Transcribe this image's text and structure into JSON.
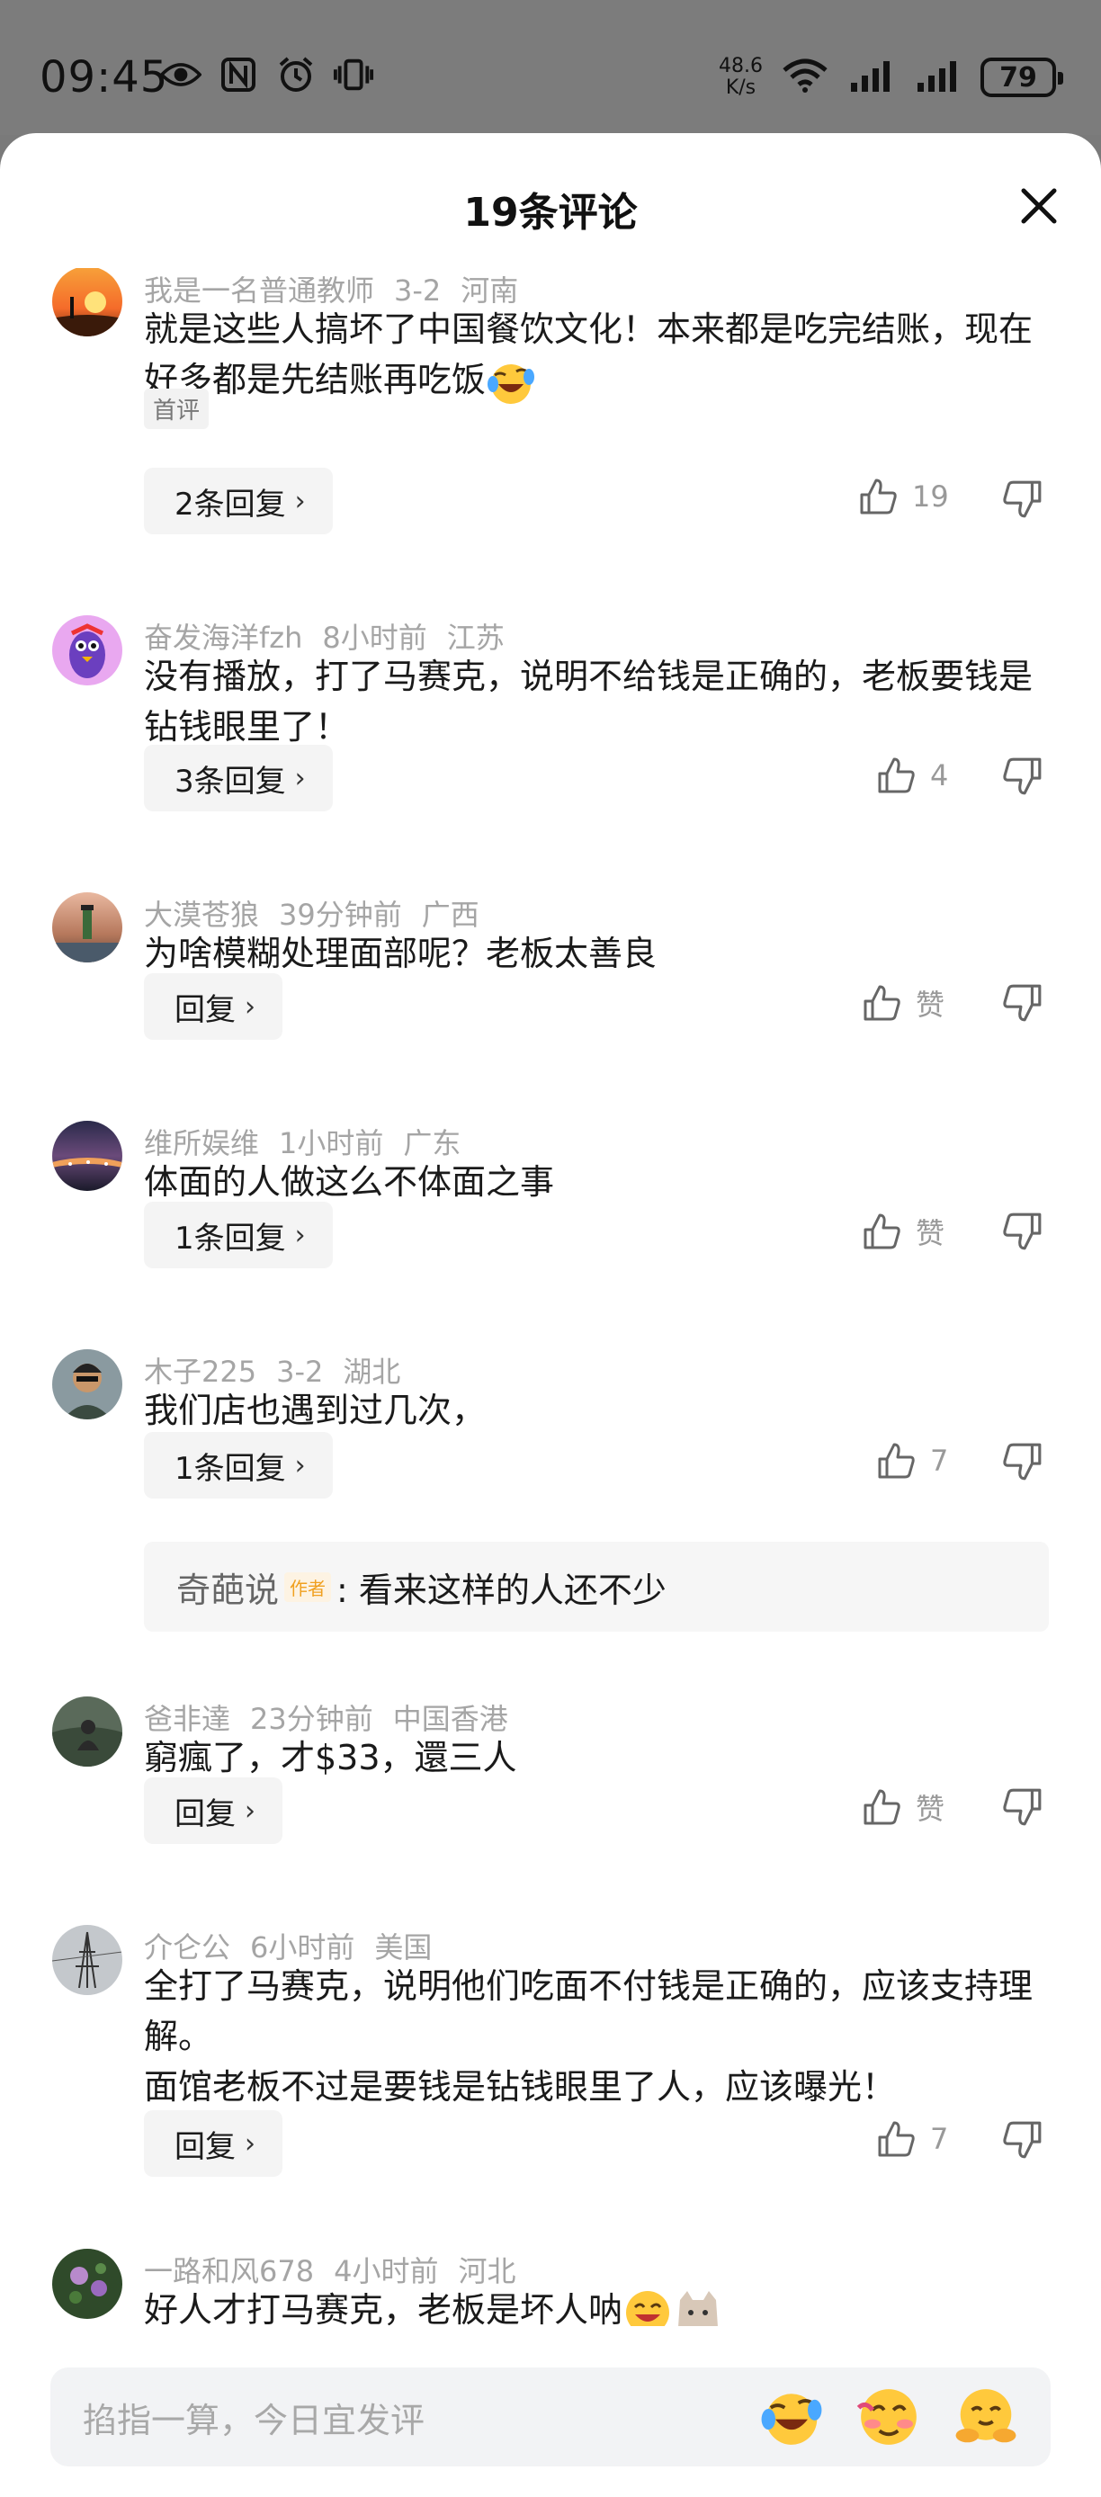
{
  "status_bar": {
    "time": "09:45",
    "speed_value": "48.6",
    "speed_unit": "K/s",
    "battery": "79"
  },
  "sheet": {
    "title": "19条评论"
  },
  "comments": [
    {
      "user": "我是一名普通教师",
      "time": "3-2",
      "location": "河南",
      "text": "就是这些人搞坏了中国餐饮文化！本来都是吃完结账，现在好多都是先结账再吃饭",
      "tag": "首评",
      "reply_label": "2条回复",
      "likes": "19"
    },
    {
      "user": "奋发海洋fzh",
      "time": "8小时前",
      "location": "江苏",
      "text": "没有播放，打了马赛克，说明不给钱是正确的，老板要钱是钻钱眼里了！",
      "reply_label": "3条回复",
      "likes": "4"
    },
    {
      "user": "大漠苍狼",
      "time": "39分钟前",
      "location": "广西",
      "text": "为啥模糊处理面部呢？老板太善良",
      "reply_label": "回复",
      "likes": "赞"
    },
    {
      "user": "维所娱维",
      "time": "1小时前",
      "location": "广东",
      "text": "体面的人做这么不体面之事",
      "reply_label": "1条回复",
      "likes": "赞"
    },
    {
      "user": "木子225",
      "time": "3-2",
      "location": "湖北",
      "text": "我们店也遇到过几次，",
      "reply_label": "1条回复",
      "likes": "7",
      "sub_reply": {
        "user": "奇葩说",
        "author_tag": "作者",
        "text": ": 看来这样的人还不少"
      }
    },
    {
      "user": "爸非達",
      "time": "23分钟前",
      "location": "中国香港",
      "text": "窮瘋了，才$33，還三人",
      "reply_label": "回复",
      "likes": "赞"
    },
    {
      "user": "介仑公",
      "time": "6小时前",
      "location": "美国",
      "text_line1": "全打了马赛克，说明他们吃面不付钱是正确的，应该支持理解。",
      "text_line2": "面馆老板不过是要钱是钻钱眼里了人，应该曝光！",
      "reply_label": "回复",
      "likes": "7"
    },
    {
      "user": "一路和风678",
      "time": "4小时前",
      "location": "河北",
      "text": "好人才打马赛克，老板是坏人呐"
    }
  ],
  "input": {
    "placeholder": "掐指一算，今日宜发评"
  },
  "icons": [
    "eye-icon",
    "nfc-icon",
    "alarm-icon",
    "vibrate-icon",
    "wifi-icon",
    "signal-icon",
    "close-icon",
    "thumb-up-icon",
    "thumb-down-icon",
    "chevron-right-icon"
  ]
}
